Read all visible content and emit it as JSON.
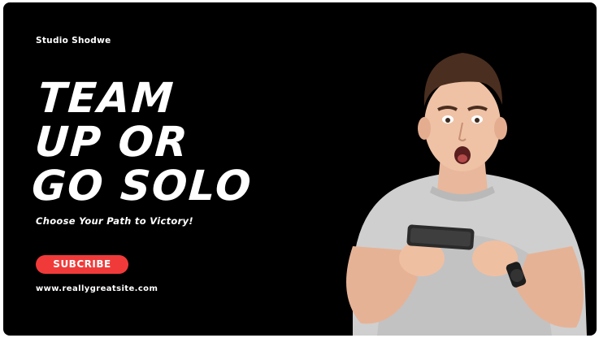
{
  "brand": {
    "name": "Studio Shodwe"
  },
  "headline": {
    "lines": [
      "TEAM",
      "UP OR",
      "GO SOLO"
    ]
  },
  "tagline": "Choose Your Path to Victory!",
  "cta": {
    "label": "SUBCRIBE"
  },
  "website": "www.reallygreatsite.com",
  "colors": {
    "background": "#000000",
    "accent": "#f03a3a",
    "text": "#ffffff"
  },
  "image": {
    "subject": "surprised-gamer-with-phone"
  }
}
